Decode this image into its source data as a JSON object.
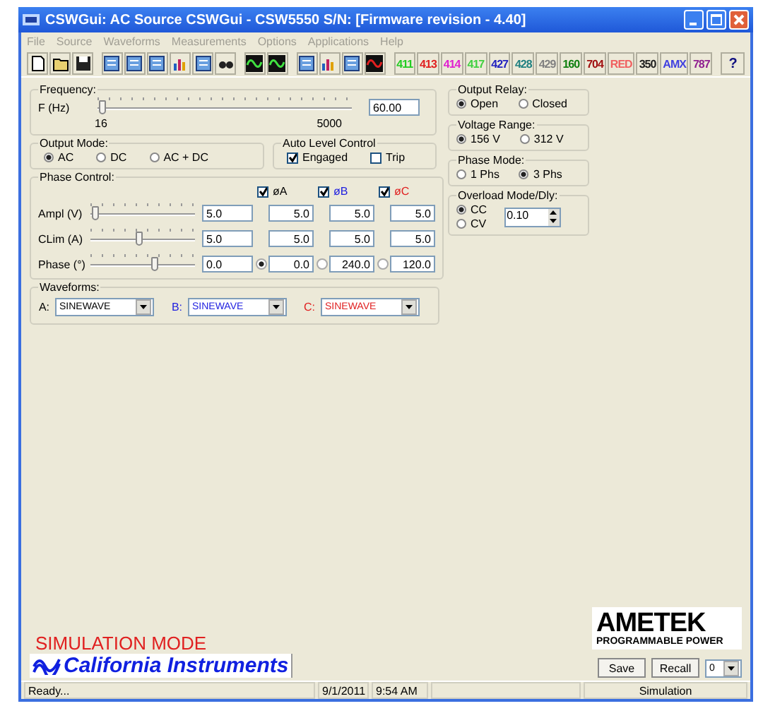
{
  "window": {
    "title": "CSWGui: AC Source CSWGui - CSW5550 S/N:  [Firmware revision - 4.40]"
  },
  "menu": [
    "File",
    "Source",
    "Waveforms",
    "Measurements",
    "Options",
    "Applications",
    "Help"
  ],
  "toolbar": {
    "buttons": [
      {
        "label": "411",
        "color": "#22cc22"
      },
      {
        "label": "413",
        "color": "#e02020"
      },
      {
        "label": "414",
        "color": "#e020d0"
      },
      {
        "label": "417",
        "color": "#40d040"
      },
      {
        "label": "427",
        "color": "#2020c0"
      },
      {
        "label": "428",
        "color": "#208080"
      },
      {
        "label": "429",
        "color": "#808080"
      },
      {
        "label": "160",
        "color": "#108010"
      },
      {
        "label": "704",
        "color": "#a01010"
      },
      {
        "label": "RED",
        "color": "#f06060"
      },
      {
        "label": "350",
        "color": "#202020"
      },
      {
        "label": "AMX",
        "color": "#4040e0"
      },
      {
        "label": "787",
        "color": "#902090"
      }
    ],
    "help": "?"
  },
  "frequency": {
    "title": "Frequency:",
    "label": "F (Hz)",
    "level": 0.01,
    "min": "16",
    "max": "5000",
    "value": "60.00"
  },
  "output_mode": {
    "title": "Output Mode:",
    "options": [
      {
        "label": "AC",
        "selected": true
      },
      {
        "label": "DC",
        "selected": false
      },
      {
        "label": "AC + DC",
        "selected": false
      }
    ]
  },
  "auto_level": {
    "title": "Auto Level Control",
    "options": [
      {
        "label": "Engaged",
        "checked": true
      },
      {
        "label": "Trip",
        "checked": false
      }
    ]
  },
  "phase_control": {
    "title": "Phase Control:",
    "phases": [
      {
        "label": "øA",
        "checked": true,
        "color": "#000000"
      },
      {
        "label": "øB",
        "checked": true,
        "color": "#2020e0"
      },
      {
        "label": "øC",
        "checked": true,
        "color": "#e02020"
      }
    ],
    "rows": [
      {
        "label": "Ampl (V)",
        "level": 0.03,
        "all": "5.0",
        "values": [
          {
            "value": "5.0"
          },
          {
            "value": "5.0"
          },
          {
            "value": "5.0"
          }
        ]
      },
      {
        "label": "CLim (A)",
        "level": 0.45,
        "all": "5.0",
        "values": [
          {
            "value": "5.0"
          },
          {
            "value": "5.0"
          },
          {
            "value": "5.0"
          }
        ]
      },
      {
        "label": "Phase (°)",
        "level": 0.6,
        "all": "0.0",
        "values": [
          {
            "value": "0.0",
            "selected": true
          },
          {
            "value": "240.0",
            "selected": false
          },
          {
            "value": "120.0",
            "selected": false
          }
        ]
      }
    ]
  },
  "waveforms": {
    "title": "Waveforms:",
    "items": [
      {
        "label": "A:",
        "value": "SINEWAVE",
        "color": "#000000"
      },
      {
        "label": "B:",
        "value": "SINEWAVE",
        "color": "#2020e0"
      },
      {
        "label": "C:",
        "value": "SINEWAVE",
        "color": "#e02020"
      }
    ]
  },
  "output_relay": {
    "title": "Output Relay:",
    "options": [
      {
        "label": "Open",
        "selected": true
      },
      {
        "label": "Closed",
        "selected": false
      }
    ]
  },
  "voltage_range": {
    "title": "Voltage Range:",
    "options": [
      {
        "label": "156 V",
        "selected": true
      },
      {
        "label": "312 V",
        "selected": false
      }
    ]
  },
  "phase_mode": {
    "title": "Phase Mode:",
    "options": [
      {
        "label": "1 Phs",
        "selected": false
      },
      {
        "label": "3 Phs",
        "selected": true
      }
    ]
  },
  "overload": {
    "title": "Overload Mode/Dly:",
    "options": [
      {
        "label": "CC",
        "selected": true
      },
      {
        "label": "CV",
        "selected": false
      }
    ],
    "value": "0.10"
  },
  "simulation_mode": "SIMULATION MODE",
  "brand": "California Instruments",
  "ametek": {
    "name": "AMETEK",
    "tagline": "PROGRAMMABLE POWER"
  },
  "buttons": {
    "save": "Save",
    "recall": "Recall",
    "slot": "0"
  },
  "status_bar": [
    "Ready...",
    "9/1/2011",
    "9:54 AM",
    "Simulation"
  ]
}
